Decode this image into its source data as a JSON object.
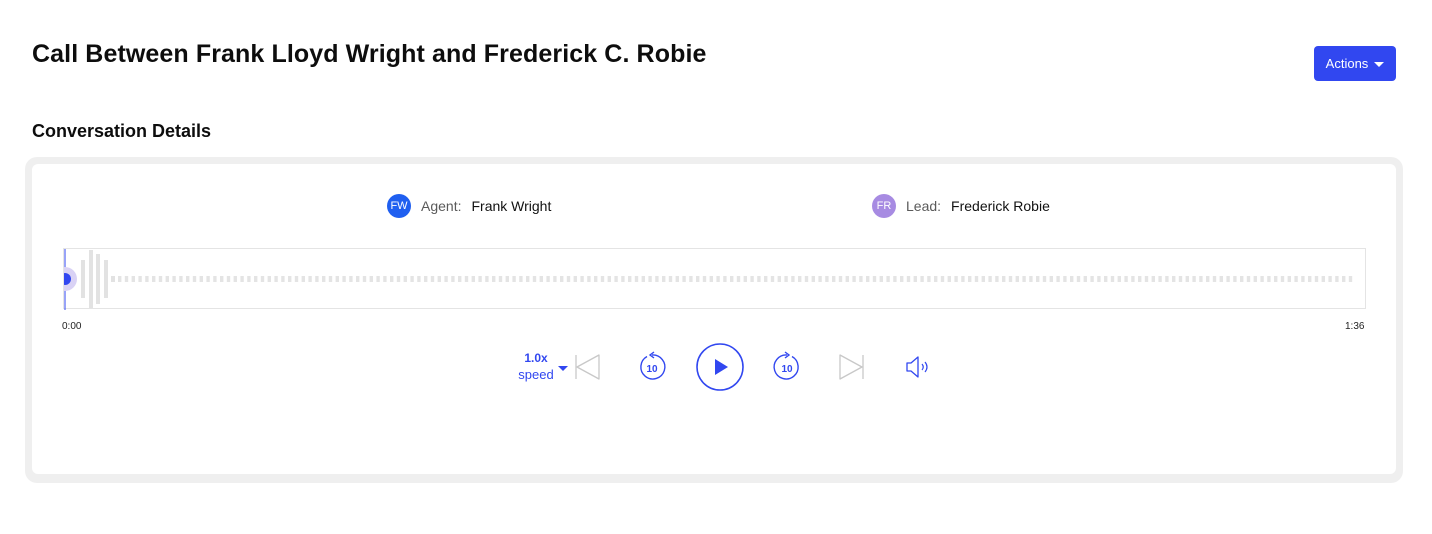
{
  "header": {
    "title": "Call Between Frank Lloyd Wright and Frederick C. Robie",
    "actions_label": "Actions"
  },
  "section": {
    "title": "Conversation Details"
  },
  "participants": {
    "agent": {
      "initials": "FW",
      "role": "Agent:",
      "name": "Frank Wright",
      "color": "#1f5ff0"
    },
    "lead": {
      "initials": "FR",
      "role": "Lead:",
      "name": "Frederick Robie",
      "color": "#a78be2"
    }
  },
  "player": {
    "current_time": "0:00",
    "duration": "1:36",
    "progress": 0,
    "speed_value": "1.0x",
    "speed_label": "speed",
    "skip_back_seconds": "10",
    "skip_forward_seconds": "10",
    "accent_color": "#3147f0"
  }
}
